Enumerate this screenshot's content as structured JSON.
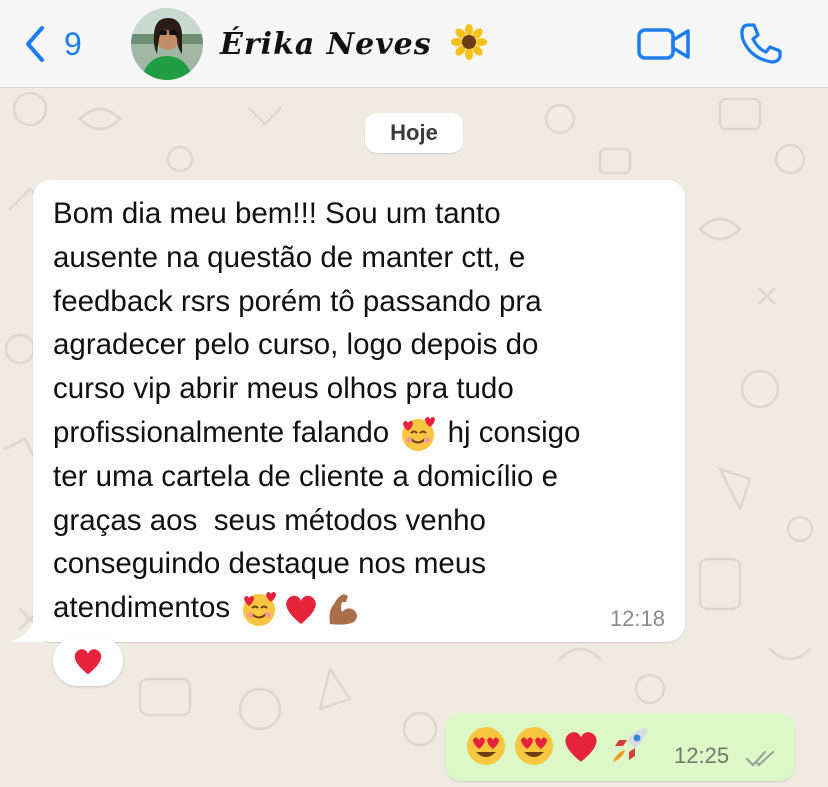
{
  "header": {
    "back_count": "9",
    "contact_name": "Érika Neves",
    "name_emoji": "sunflower",
    "accent_color": "#1a7ef2"
  },
  "date_label": "Hoje",
  "incoming_message": {
    "text_lines": [
      "Bom dia meu bem!!! Sou um tanto",
      "ausente na questão de manter ctt, e",
      "feedback rsrs porém tô passando pra",
      "agradecer pelo curso, logo depois do",
      "curso vip abrir meus olhos pra tudo",
      "profissionalmente falando",
      "hj consigo",
      "ter uma cartela de cliente a domicílio e",
      "graças aos  seus métodos venho",
      "conseguindo destaque nos meus",
      "atendimentos"
    ],
    "time": "12:18",
    "reaction": "red-heart"
  },
  "outgoing_message": {
    "emojis": [
      "heart-eyes",
      "heart-eyes",
      "red-heart",
      "rocket"
    ],
    "time": "12:25",
    "status": "read"
  },
  "colors": {
    "background": "#efeae2",
    "incoming_bubble": "#ffffff",
    "outgoing_bubble": "#dcf8c6"
  }
}
